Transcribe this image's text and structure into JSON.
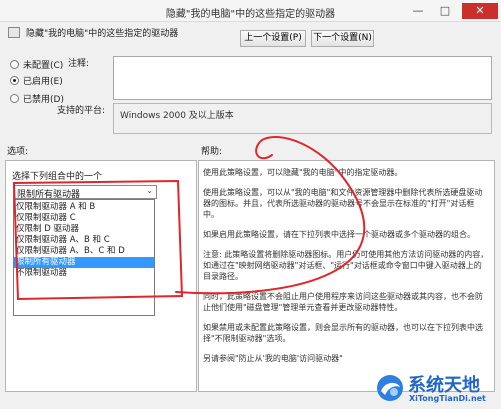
{
  "window": {
    "title": "隐藏\"我的电脑\"中的这些指定的驱动器",
    "minimize": "—",
    "maximize": "□",
    "close": "✕"
  },
  "header": {
    "policy_name": "隐藏\"我的电脑\"中的这些指定的驱动器",
    "icon": "policy-icon"
  },
  "nav": {
    "prev": "上一个设置(P)",
    "next": "下一个设置(N)"
  },
  "state": {
    "options": [
      {
        "label": "未配置(C)",
        "checked": false
      },
      {
        "label": "已启用(E)",
        "checked": true
      },
      {
        "label": "已禁用(D)",
        "checked": false
      }
    ]
  },
  "fields": {
    "comment_label": "注释:",
    "platform_label": "支持的平台:",
    "platform_value": "Windows 2000 及以上版本"
  },
  "options_panel": {
    "section": "选项:",
    "title": "选择下列组合中的一个",
    "selected": "限制所有驱动器",
    "items": [
      "仅限制驱动器 A 和 B",
      "仅限制驱动器 C",
      "仅限制 D 驱动器",
      "仅限制驱动器 A、B 和 C",
      "仅限制驱动器 A、B、C 和 D",
      "限制所有驱动器",
      "不限制驱动器"
    ]
  },
  "help_panel": {
    "section": "帮助:",
    "paragraphs": [
      "使用此策略设置，可以隐藏\"我的电脑\"中的指定驱动器。",
      "使用此策略设置，可以从\"我的电脑\"和文件资源管理器中删除代表所选硬盘驱动器的图标。并且，代表所选驱动器的驱动器号不会显示在标准的\"打开\"对话框中。",
      "如果启用此策略设置，请在下拉列表中选择一个驱动器或多个驱动器的组合。",
      "注意: 此策略设置将删除驱动器图标。用户仍可使用其他方法访问驱动器的内容，如通过在\"映射网络驱动器\"对话框、\"运行\"对话框或命令窗口中键入驱动器上的目录路径。",
      "同时，此策略设置不会阻止用户使用程序来访问这些驱动器或其内容，也不会防止他们使用\"磁盘管理\"管理单元查看并更改驱动器特性。",
      "如果禁用或未配置此策略设置，则会显示所有的驱动器，也可以在下拉列表中选择\"不限制驱动器\"选项。",
      "另请参阅\"防止从'我的电脑'访问驱动器\""
    ]
  },
  "annotation": {
    "color": "#e0262a"
  },
  "watermark": {
    "text": "系统天地",
    "url": "XiTongTianDi.net",
    "color": "#1f66c7"
  }
}
